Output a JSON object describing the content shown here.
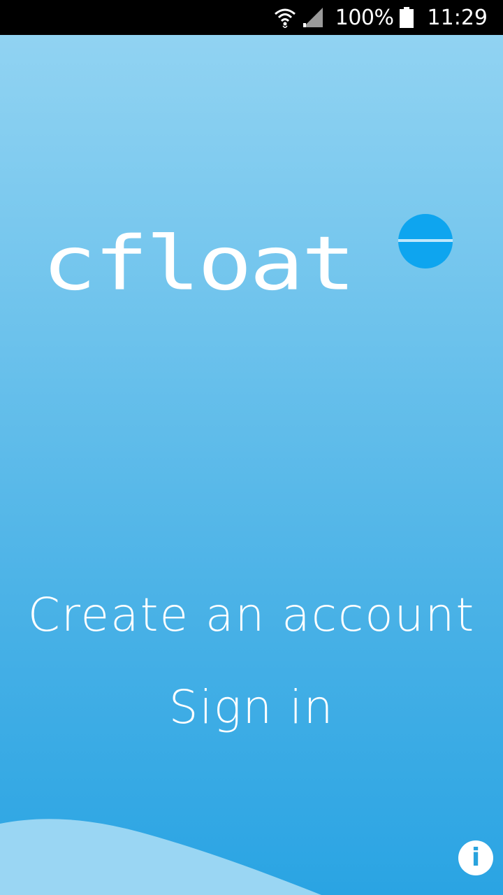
{
  "status_bar": {
    "battery_percent": "100%",
    "time": "11:29",
    "icons": [
      "wifi-icon",
      "signal-icon",
      "battery-icon"
    ]
  },
  "logo": {
    "text": "cfloat",
    "accent_color": "#0ea5ef"
  },
  "menu": {
    "create_account_label": "Create an account",
    "sign_in_label": "Sign in"
  },
  "info_button": {
    "glyph": "i",
    "icon": "info-icon"
  },
  "colors": {
    "background_top": "#91d3f2",
    "background_bottom": "#2aa4e3",
    "wave": "#9ad6f3"
  }
}
